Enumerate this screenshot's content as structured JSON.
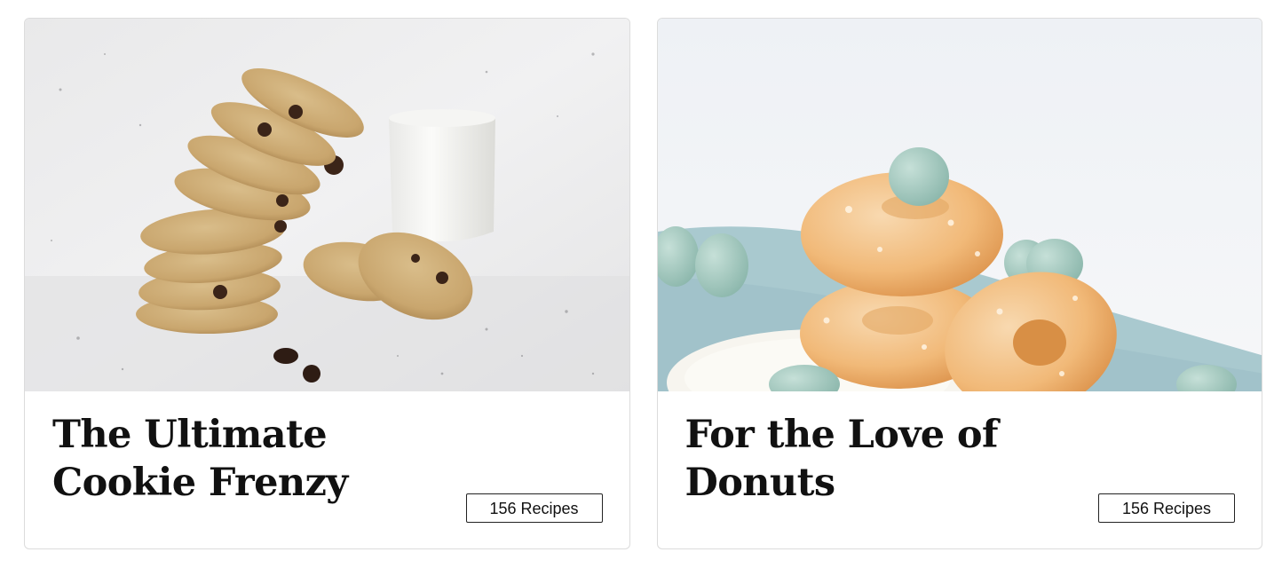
{
  "cards": [
    {
      "title": "The Ultimate Cookie Frenzy",
      "badge": "156 Recipes",
      "image_name": "cookie-stack-with-milk"
    },
    {
      "title": "For the Love of Donuts",
      "badge": "156 Recipes",
      "image_name": "glazed-donuts-with-pastel-eggs"
    }
  ],
  "colors": {
    "title": "#111111",
    "card_border": "#dcdcdc",
    "badge_border": "#222222"
  }
}
